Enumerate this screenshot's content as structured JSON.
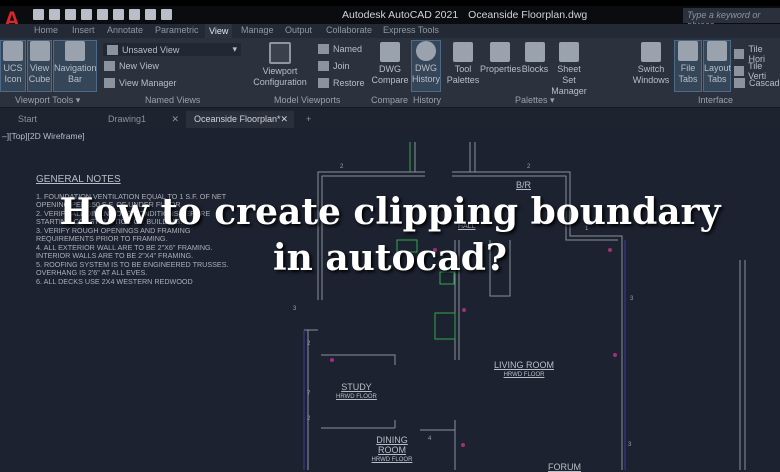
{
  "app": {
    "title": "Autodesk AutoCAD 2021",
    "file": "Oceanside Floorplan.dwg",
    "logo": "A",
    "search_placeholder": "Type a keyword or phrase"
  },
  "ribbon_tabs": [
    "Home",
    "Insert",
    "Annotate",
    "Parametric",
    "View",
    "Manage",
    "Output",
    "Collaborate",
    "Express Tools"
  ],
  "ribbon": {
    "ucs": "UCS Icon",
    "viewcube": "View Cube",
    "navbar": "Navigation Bar",
    "viewport_tools": "Viewport Tools ▾",
    "unsaved_view": "Unsaved View",
    "new_view": "New View",
    "view_manager": "View Manager",
    "named_views": "Named Views",
    "viewport_config": "Viewport Configuration",
    "named": "Named",
    "join": "Join",
    "restore": "Restore",
    "model_viewports": "Model Viewports",
    "dwg_compare": "DWG Compare",
    "compare": "Compare",
    "dwg_history": "DWG History",
    "history": "History",
    "tool_palettes": "Tool Palettes",
    "properties": "Properties",
    "blocks": "Blocks",
    "sheet_set": "Sheet Set Manager",
    "palettes": "Palettes ▾",
    "switch_windows": "Switch Windows",
    "file_tabs": "File Tabs",
    "layout_tabs": "Layout Tabs",
    "tile_h": "Tile Hori",
    "tile_v": "Tile Verti",
    "cascade": "Cascade",
    "interface": "Interface"
  },
  "doc_tabs": [
    {
      "label": "Start"
    },
    {
      "label": "Drawing1",
      "close": "✕"
    },
    {
      "label": "Oceanside Floorplan*",
      "close": "✕"
    },
    {
      "label": "+"
    }
  ],
  "viewport_label": "–][Top][2D Wireframe]",
  "notes": {
    "title": "GENERAL NOTES",
    "lines": [
      "1.   FOUNDATION VENTILATION EQUAL TO 1 S.F. OF NET",
      "      OPENING PER 150 S.F. OF UNDER FLOOR",
      "2.   VERIFY ALL DIMENSIONS/CONDITIONS BEFORE",
      "      STARTING CONSTRUCTION OR BUILDING.",
      "3.   VERIFY ROUGH OPENINGS AND FRAMING",
      "      REQUIREMENTS PRIOR TO FRAMING.",
      "4.   ALL EXTERIOR WALL ARE TO BE 2\"X6\" FRAMING.",
      "      INTERIOR WALLS ARE TO BE 2\"X4\" FRAMING.",
      "5.   ROOFING SYSTEM IS TO BE ENGINEERED TRUSSES.",
      "      OVERHANG IS 2'6\" AT ALL EVES.",
      "6.   ALL DECKS USE 2X4 WESTERN REDWOOD"
    ]
  },
  "rooms": {
    "br": "B/R",
    "hall": "HALL",
    "living": "LIVING ROOM",
    "study": "STUDY",
    "dining": "DINING ROOM",
    "forum": "FORUM",
    "floor": "HRWD FLOOR"
  },
  "headline": {
    "line1": "How to create clipping boundary",
    "line2": "in autocad?"
  }
}
